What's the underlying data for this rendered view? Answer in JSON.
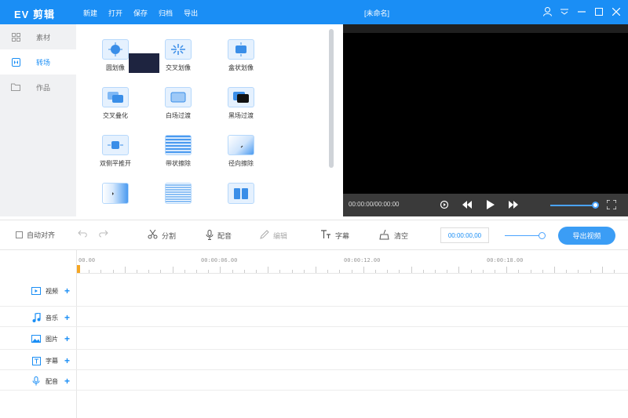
{
  "app": {
    "logo": "EV 剪辑",
    "doc_title": "[未命名]"
  },
  "menu": [
    "新建",
    "打开",
    "保存",
    "归档",
    "导出"
  ],
  "sidebar": {
    "items": [
      {
        "label": "素材",
        "icon": "grid-icon",
        "active": false
      },
      {
        "label": "转场",
        "icon": "transition-icon",
        "active": true
      },
      {
        "label": "作品",
        "icon": "folder-icon",
        "active": false
      }
    ]
  },
  "transitions": [
    {
      "label": "圆划像",
      "icon": "circle-wipe-icon"
    },
    {
      "label": "交叉划像",
      "icon": "cross-wipe-icon"
    },
    {
      "label": "盒状划像",
      "icon": "box-wipe-icon"
    },
    {
      "label": "交叉叠化",
      "icon": "cross-dissolve-icon"
    },
    {
      "label": "白场过渡",
      "icon": "white-fade-icon"
    },
    {
      "label": "黑场过渡",
      "icon": "black-fade-icon"
    },
    {
      "label": "双侧平推开",
      "icon": "split-push-icon"
    },
    {
      "label": "带状擦除",
      "icon": "band-wipe-icon"
    },
    {
      "label": "径向擦除",
      "icon": "radial-wipe-icon"
    },
    {
      "label": "",
      "icon": "slide-icon"
    },
    {
      "label": "",
      "icon": "stripes-icon"
    },
    {
      "label": "",
      "icon": "doors-icon"
    }
  ],
  "preview": {
    "time": "00:00:00/00:00:00",
    "volume_fraction": 0.9
  },
  "toolbar": {
    "auto_align": "自动对齐",
    "split": "分割",
    "dub": "配音",
    "edit": "编辑",
    "subtitle": "字幕",
    "clear": "清空",
    "timecode": "00:00:00,00",
    "export": "导出视频"
  },
  "ruler": [
    "00.00",
    "00:00:06.00",
    "00:00:12.00",
    "00:00:18.00"
  ],
  "tracks": [
    {
      "label": "视频",
      "icon": "video-icon"
    },
    {
      "label": "音乐",
      "icon": "music-icon"
    },
    {
      "label": "图片",
      "icon": "image-icon"
    },
    {
      "label": "字幕",
      "icon": "text-icon"
    },
    {
      "label": "配音",
      "icon": "mic-icon"
    }
  ],
  "colors": {
    "accent": "#1a8ef5",
    "preview_bg": "#000000",
    "playhead": "#f5a623"
  }
}
